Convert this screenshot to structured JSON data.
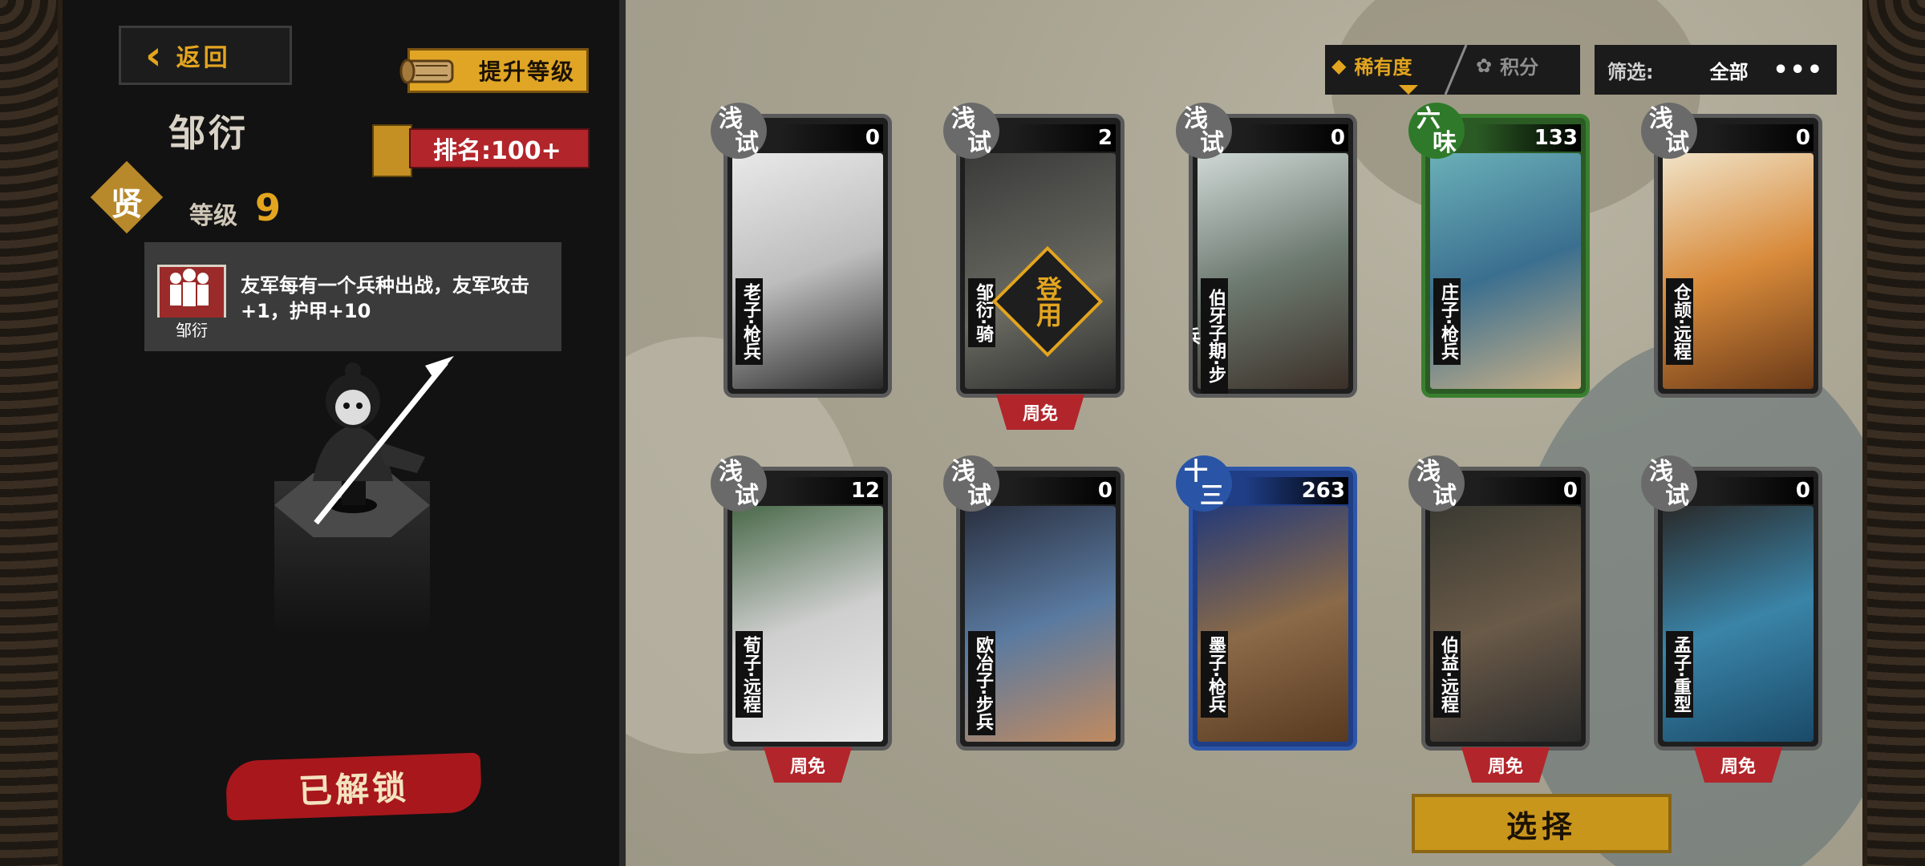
{
  "header": {
    "back_label": "返回",
    "upgrade_label": "提升等级",
    "hero_name": "邹衍",
    "rank_label": "排名:100+",
    "grade_char": "贤",
    "level_label": "等级",
    "level_value": "9"
  },
  "skill": {
    "icon_label": "邹衍",
    "text": "友军每有一个兵种出战，友军攻击+1，护甲+10"
  },
  "status": {
    "unlocked_label": "已解锁"
  },
  "sort": {
    "rarity_label": "稀有度",
    "score_label": "积分"
  },
  "filter": {
    "label": "筛选:",
    "value": "全部",
    "more": "•••"
  },
  "cards": [
    {
      "badge": "浅试",
      "count": "0",
      "name": "老子",
      "type": "枪兵",
      "weekfree": "",
      "overlay": ""
    },
    {
      "badge": "浅试",
      "count": "2",
      "name": "邹衍",
      "type": "骑",
      "weekfree": "周免",
      "overlay": "登用"
    },
    {
      "badge": "浅试",
      "count": "0",
      "name": "伯牙子期",
      "type": "步兵",
      "weekfree": "",
      "overlay": ""
    },
    {
      "badge": "六味",
      "count": "133",
      "name": "庄子",
      "type": "枪兵",
      "weekfree": "",
      "overlay": ""
    },
    {
      "badge": "浅试",
      "count": "0",
      "name": "仓颉",
      "type": "远程",
      "weekfree": "",
      "overlay": ""
    },
    {
      "badge": "浅试",
      "count": "12",
      "name": "荀子",
      "type": "远程",
      "weekfree": "周免",
      "overlay": ""
    },
    {
      "badge": "浅试",
      "count": "0",
      "name": "欧冶子",
      "type": "步兵",
      "weekfree": "",
      "overlay": ""
    },
    {
      "badge": "十三",
      "count": "263",
      "name": "墨子",
      "type": "枪兵",
      "weekfree": "",
      "overlay": ""
    },
    {
      "badge": "浅试",
      "count": "0",
      "name": "伯益",
      "type": "远程",
      "weekfree": "周免",
      "overlay": ""
    },
    {
      "badge": "浅试",
      "count": "0",
      "name": "孟子",
      "type": "重型",
      "weekfree": "周免",
      "overlay": ""
    }
  ],
  "select_label": "选择"
}
